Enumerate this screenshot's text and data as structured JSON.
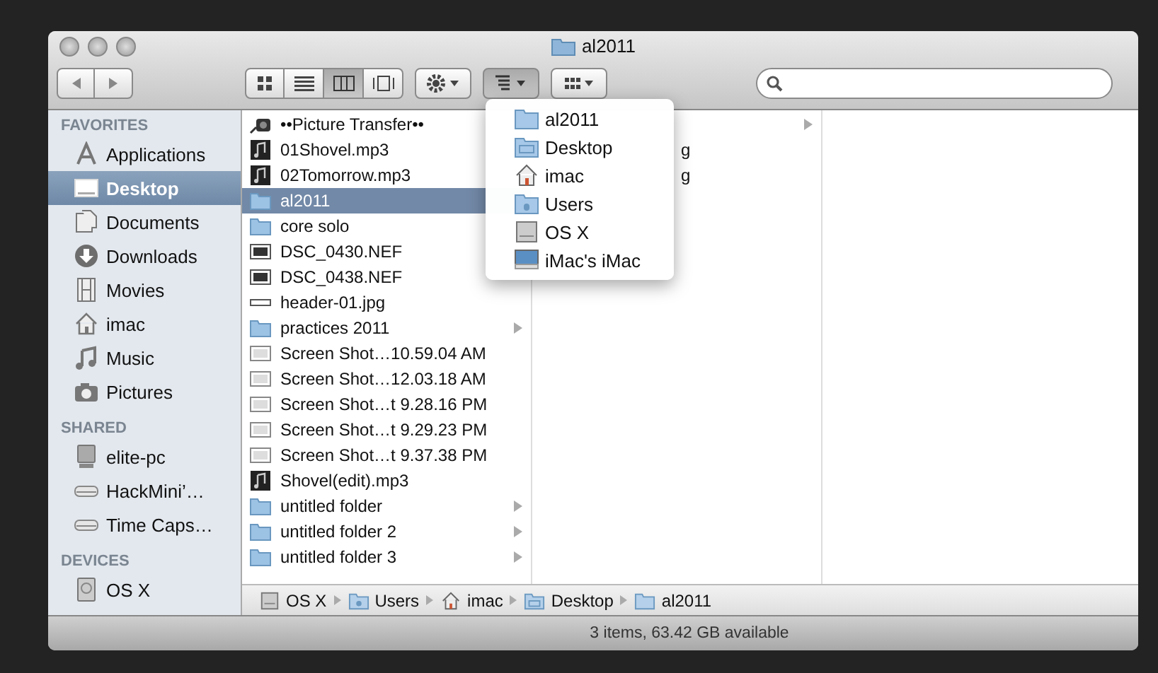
{
  "window": {
    "title": "al2011"
  },
  "toolbar": {
    "view_buttons": [
      {
        "kind": "icons",
        "selected": false
      },
      {
        "kind": "list",
        "selected": false
      },
      {
        "kind": "columns",
        "selected": true
      },
      {
        "kind": "coverflow",
        "selected": false
      }
    ],
    "arrange_open": true
  },
  "sidebar": {
    "sections": [
      {
        "title": "FAVORITES",
        "items": [
          {
            "label": "Applications",
            "kind": "apps",
            "selected": false
          },
          {
            "label": "Desktop",
            "kind": "desktop",
            "selected": true
          },
          {
            "label": "Documents",
            "kind": "docs",
            "selected": false
          },
          {
            "label": "Downloads",
            "kind": "download",
            "selected": false
          },
          {
            "label": "Movies",
            "kind": "film",
            "selected": false
          },
          {
            "label": "imac",
            "kind": "home",
            "selected": false
          },
          {
            "label": "Music",
            "kind": "music",
            "selected": false
          },
          {
            "label": "Pictures",
            "kind": "camera",
            "selected": false
          }
        ]
      },
      {
        "title": "SHARED",
        "items": [
          {
            "label": "elite-pc",
            "kind": "monitor",
            "selected": false
          },
          {
            "label": "HackMini’…",
            "kind": "drive",
            "selected": false
          },
          {
            "label": "Time Caps…",
            "kind": "drive",
            "selected": false
          }
        ]
      },
      {
        "title": "DEVICES",
        "items": [
          {
            "label": "OS X",
            "kind": "disk",
            "selected": false
          }
        ]
      }
    ]
  },
  "columns": [
    [
      {
        "name": "••Picture Transfer••",
        "kind": "app",
        "expandable": false,
        "selected": false
      },
      {
        "name": "01Shovel.mp3",
        "kind": "audio",
        "expandable": false,
        "selected": false
      },
      {
        "name": "02Tomorrow.mp3",
        "kind": "audio",
        "expandable": false,
        "selected": false
      },
      {
        "name": "al2011",
        "kind": "folder",
        "expandable": false,
        "selected": true
      },
      {
        "name": "core solo",
        "kind": "folder",
        "expandable": false,
        "selected": false
      },
      {
        "name": "DSC_0430.NEF",
        "kind": "image",
        "expandable": false,
        "selected": false
      },
      {
        "name": "DSC_0438.NEF",
        "kind": "image",
        "expandable": false,
        "selected": false
      },
      {
        "name": "header-01.jpg",
        "kind": "strip",
        "expandable": false,
        "selected": false
      },
      {
        "name": "practices 2011",
        "kind": "folder",
        "expandable": true,
        "selected": false
      },
      {
        "name": "Screen Shot…10.59.04 AM",
        "kind": "shot",
        "expandable": false,
        "selected": false
      },
      {
        "name": "Screen Shot…12.03.18 AM",
        "kind": "shot",
        "expandable": false,
        "selected": false
      },
      {
        "name": "Screen Shot…t 9.28.16 PM",
        "kind": "shot",
        "expandable": false,
        "selected": false
      },
      {
        "name": "Screen Shot…t 9.29.23 PM",
        "kind": "shot",
        "expandable": false,
        "selected": false
      },
      {
        "name": "Screen Shot…t 9.37.38 PM",
        "kind": "shot",
        "expandable": false,
        "selected": false
      },
      {
        "name": "Shovel(edit).mp3",
        "kind": "audio",
        "expandable": false,
        "selected": false
      },
      {
        "name": "untitled folder",
        "kind": "folder",
        "expandable": true,
        "selected": false
      },
      {
        "name": "untitled folder 2",
        "kind": "folder",
        "expandable": true,
        "selected": false
      },
      {
        "name": "untitled folder 3",
        "kind": "folder",
        "expandable": true,
        "selected": false
      }
    ],
    [
      {
        "expandable": true,
        "selected": false
      },
      {
        "name": "g",
        "expandable": false,
        "selected": false
      },
      {
        "name": "g",
        "expandable": false,
        "selected": false
      }
    ]
  ],
  "path_menu": [
    {
      "label": "al2011",
      "kind": "folder"
    },
    {
      "label": "Desktop",
      "kind": "desktop-folder"
    },
    {
      "label": "imac",
      "kind": "home"
    },
    {
      "label": "Users",
      "kind": "users"
    },
    {
      "label": "OS X",
      "kind": "disk"
    },
    {
      "label": "iMac's iMac",
      "kind": "monitor"
    }
  ],
  "path_bar": [
    {
      "label": "OS X",
      "kind": "disk"
    },
    {
      "label": "Users",
      "kind": "users"
    },
    {
      "label": "imac",
      "kind": "home"
    },
    {
      "label": "Desktop",
      "kind": "desktop-folder"
    },
    {
      "label": "al2011",
      "kind": "folder"
    }
  ],
  "status_bar": "3 items, 63.42 GB available"
}
